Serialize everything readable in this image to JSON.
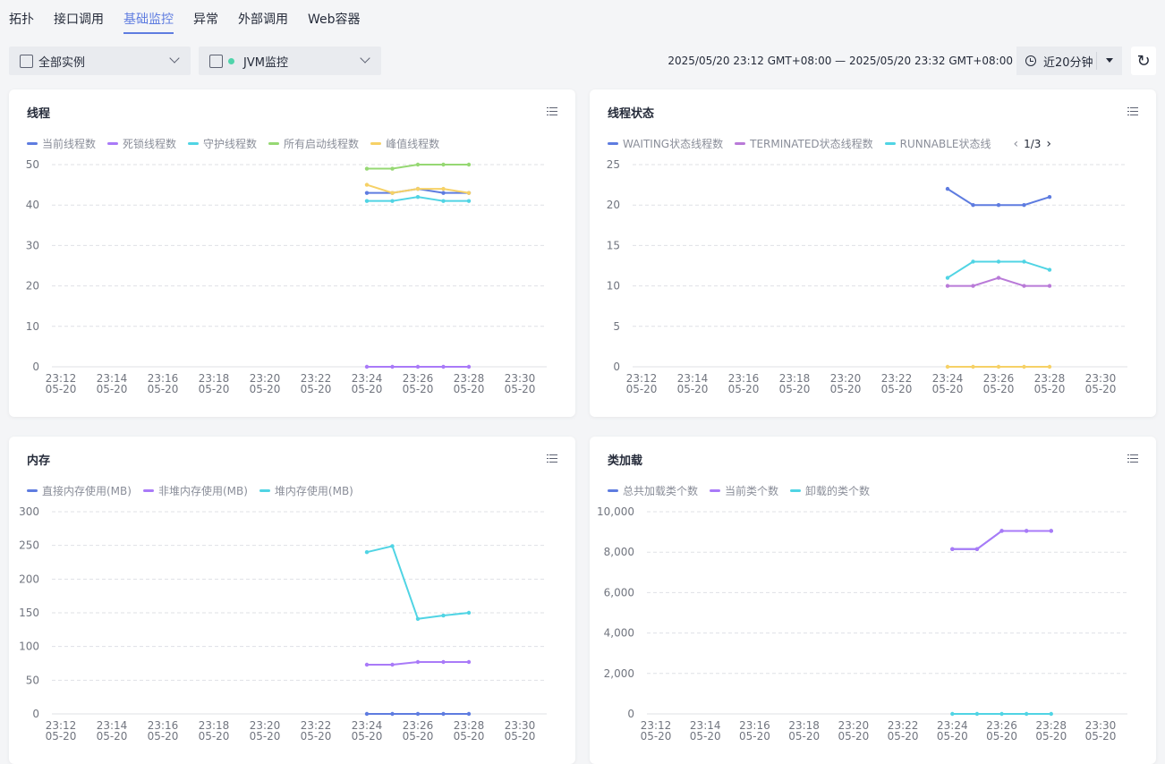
{
  "tabs": [
    "拓扑",
    "接口调用",
    "基础监控",
    "异常",
    "外部调用",
    "Web容器"
  ],
  "active_tab": 2,
  "toolbar": {
    "instance_label": "全部实例",
    "monitor_label": "JVM监控",
    "time_range": "2025/05/20 23:12 GMT+08:00 — 2025/05/20 23:32 GMT+08:00",
    "quick_range": "近20分钟",
    "refresh_icon": "refresh-icon"
  },
  "chart_data": [
    {
      "id": "threads",
      "type": "line",
      "title": "线程",
      "x": [
        "23:12",
        "23:14",
        "23:16",
        "23:18",
        "23:20",
        "23:22",
        "23:24",
        "23:26",
        "23:28",
        "23:30"
      ],
      "x_date": "05-20",
      "ylim": [
        0,
        50
      ],
      "yticks": [
        "0",
        "10",
        "20",
        "30",
        "40",
        "50"
      ],
      "points_x": [
        "23:24",
        "23:25",
        "23:26",
        "23:27",
        "23:28"
      ],
      "series": [
        {
          "name": "当前线程数",
          "color": "#5e7ce0",
          "values": [
            43,
            43,
            44,
            43,
            43
          ]
        },
        {
          "name": "死锁线程数",
          "color": "#a97af8",
          "values": [
            0,
            0,
            0,
            0,
            0
          ]
        },
        {
          "name": "守护线程数",
          "color": "#50d4e4",
          "values": [
            41,
            41,
            42,
            41,
            41
          ]
        },
        {
          "name": "所有启动线程数",
          "color": "#96d873",
          "values": [
            49,
            49,
            50,
            50,
            50
          ]
        },
        {
          "name": "峰值线程数",
          "color": "#f6d166",
          "values": [
            45,
            43,
            44,
            44,
            43
          ]
        }
      ]
    },
    {
      "id": "thread-state",
      "type": "line",
      "title": "线程状态",
      "x": [
        "23:12",
        "23:14",
        "23:16",
        "23:18",
        "23:20",
        "23:22",
        "23:24",
        "23:26",
        "23:28",
        "23:30"
      ],
      "x_date": "05-20",
      "ylim": [
        0,
        25
      ],
      "yticks": [
        "0",
        "5",
        "10",
        "15",
        "20",
        "25"
      ],
      "points_x": [
        "23:24",
        "23:25",
        "23:26",
        "23:27",
        "23:28"
      ],
      "legend_page": "1/3",
      "series": [
        {
          "name": "WAITING状态线程数",
          "color": "#5e7ce0",
          "values": [
            22,
            20,
            20,
            20,
            21
          ]
        },
        {
          "name": "TERMINATED状态线程数",
          "color": "#b97ad8",
          "values": [
            10,
            10,
            11,
            10,
            10
          ]
        },
        {
          "name": "RUNNABLE状态线",
          "color": "#50d4e4",
          "values": [
            11,
            13,
            13,
            13,
            12
          ]
        },
        {
          "color": "#f6d166",
          "values": [
            0,
            0,
            0,
            0,
            0
          ]
        }
      ]
    },
    {
      "id": "memory",
      "type": "line",
      "title": "内存",
      "x": [
        "23:12",
        "23:14",
        "23:16",
        "23:18",
        "23:20",
        "23:22",
        "23:24",
        "23:26",
        "23:28",
        "23:30"
      ],
      "x_date": "05-20",
      "ylim": [
        0,
        300
      ],
      "yticks": [
        "0",
        "50",
        "100",
        "150",
        "200",
        "250",
        "300"
      ],
      "points_x": [
        "23:24",
        "23:25",
        "23:26",
        "23:27",
        "23:28"
      ],
      "series": [
        {
          "name": "直接内存使用(MB)",
          "color": "#5e7ce0",
          "values": [
            0,
            0,
            0,
            0,
            0
          ]
        },
        {
          "name": "非堆内存使用(MB)",
          "color": "#a97af8",
          "values": [
            73,
            73,
            77,
            77,
            77
          ]
        },
        {
          "name": "堆内存使用(MB)",
          "color": "#50d4e4",
          "values": [
            240,
            249,
            141,
            146,
            150
          ]
        }
      ]
    },
    {
      "id": "classes",
      "type": "line",
      "title": "类加载",
      "x": [
        "23:12",
        "23:14",
        "23:16",
        "23:18",
        "23:20",
        "23:22",
        "23:24",
        "23:26",
        "23:28",
        "23:30"
      ],
      "x_date": "05-20",
      "ylim": [
        0,
        10000
      ],
      "yticks": [
        "0",
        "2,000",
        "4,000",
        "6,000",
        "8,000",
        "10,000"
      ],
      "points_x": [
        "23:24",
        "23:25",
        "23:26",
        "23:27",
        "23:28"
      ],
      "series": [
        {
          "name": "总共加载类个数",
          "color": "#5e7ce0",
          "values": [
            8150,
            8150,
            9050,
            9050,
            9050
          ]
        },
        {
          "name": "当前类个数",
          "color": "#a97af8",
          "values": [
            8150,
            8150,
            9050,
            9050,
            9050
          ]
        },
        {
          "name": "卸载的类个数",
          "color": "#50d4e4",
          "values": [
            0,
            0,
            0,
            0,
            0
          ]
        }
      ]
    }
  ]
}
